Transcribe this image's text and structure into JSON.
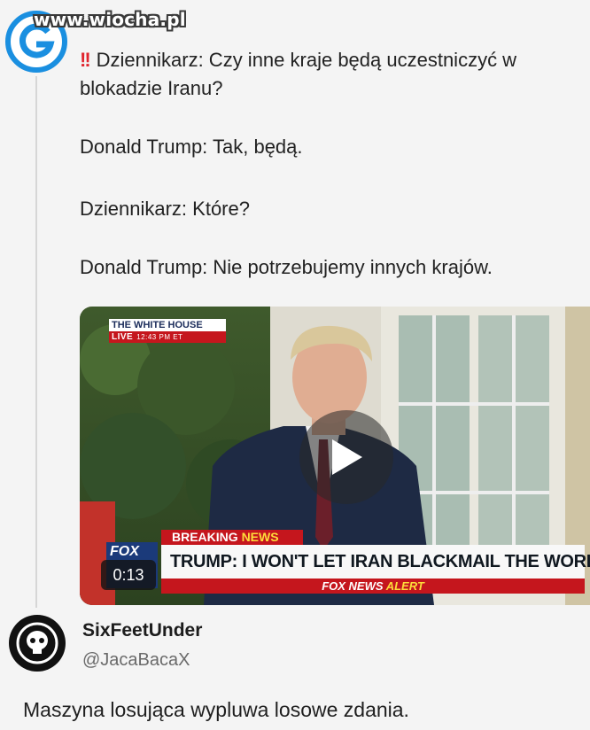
{
  "watermark": "www.wiocha.pl",
  "tweet": {
    "mark": "!!",
    "line1": "Dziennikarz: Czy inne kraje będą uczestniczyć w",
    "line1b": "blokadzie Iranu?",
    "line2": "Donald Trump: Tak, będą.",
    "line3": "Dziennikarz: Które?",
    "line4": "Donald Trump: Nie potrzebujemy innych krajów."
  },
  "video": {
    "live_top": "THE WHITE HOUSE",
    "live_label": "LIVE",
    "live_time": "12:43 PM ET",
    "breaking": "BREAKING",
    "breaking_news": "NEWS",
    "headline": "TRUMP: I WON'T LET IRAN BLACKMAIL THE WORLD",
    "alert_brand": "FOX NEWS",
    "alert_word": "ALERT",
    "fox_logo": "FOX",
    "duration": "0:13"
  },
  "reply": {
    "name": "SixFeetUnder",
    "handle": "@JacaBacaX",
    "text": "Maszyna losująca wypluwa losowe zdania."
  },
  "icons": {
    "avatar": "g-logo-avatar",
    "play": "play-icon",
    "reply_avatar": "skull-avatar"
  },
  "colors": {
    "accent_blue": "#1a8fe0",
    "fox_red": "#c5161d",
    "fox_yellow": "#fddc3a"
  }
}
